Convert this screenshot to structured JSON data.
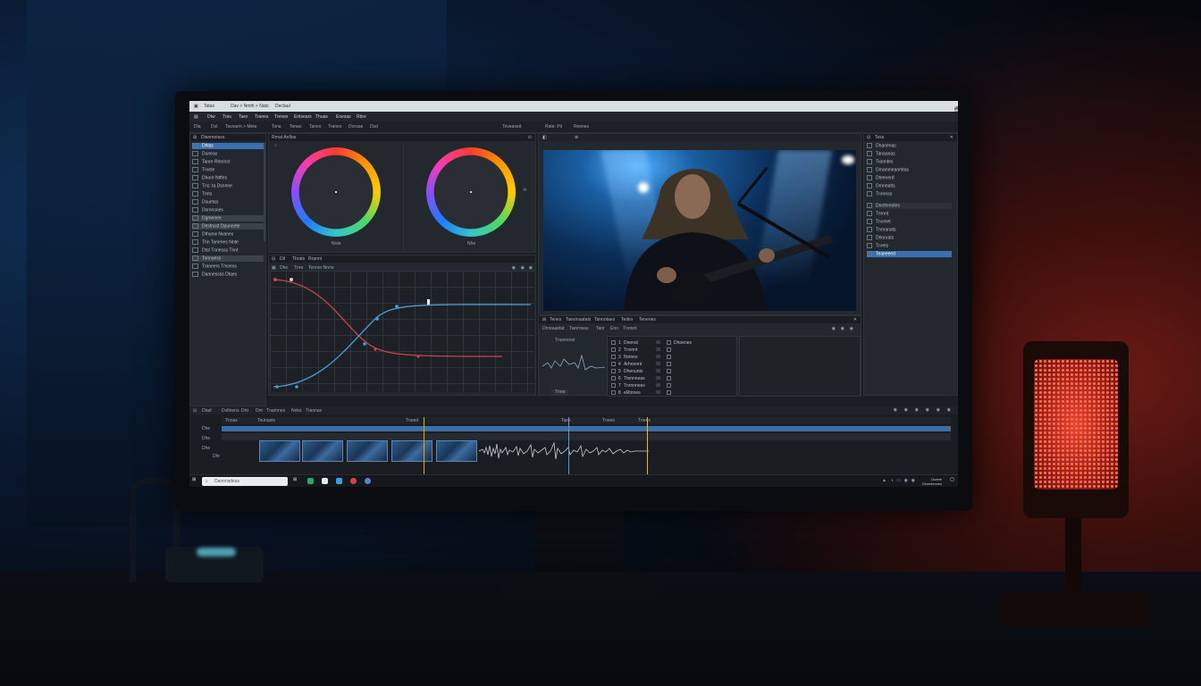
{
  "window": {
    "title_parts": [
      "Tatas",
      "Dav > Nmth > Nats",
      "Declaul"
    ],
    "controls": [
      "—",
      "▢",
      "✕"
    ]
  },
  "menu": [
    "Dtw",
    "Tras",
    "Taex",
    "Tranes",
    "Trenes",
    "Entsears",
    "Thuas",
    "Enesas",
    "Rbre"
  ],
  "toolbar": {
    "left": [
      "Dia",
      "Dxl",
      "Tavsaen > Mete",
      "Tsna",
      "Tenas",
      "Tanes",
      "Tranes",
      "Doraas",
      "Dsd"
    ],
    "viewer_tabs": [
      "Toveased",
      "Rate: Pil",
      "Resnes"
    ],
    "color_panel_title": "Rrnat Anlfas"
  },
  "left_panel": {
    "header": "Dianmetass",
    "items": [
      {
        "label": "Dhlas",
        "state": "selected"
      },
      {
        "label": "Duneas",
        "state": ""
      },
      {
        "label": "Tanre Rtennst",
        "state": ""
      },
      {
        "label": "Tnvtre",
        "state": ""
      },
      {
        "label": "Dhore Nttfes",
        "state": ""
      },
      {
        "label": "Tns: ta Dsnnne",
        "state": ""
      },
      {
        "label": "Trnts",
        "state": ""
      },
      {
        "label": "Dsuetas",
        "state": ""
      },
      {
        "label": "Dsrnnsnes",
        "state": ""
      },
      {
        "label": "Dgmenee",
        "state": "highlight"
      },
      {
        "label": "Destnsst Dpunnete",
        "state": "highlight"
      },
      {
        "label": "Dthunw Nvanes",
        "state": ""
      },
      {
        "label": "Thn Tanenes Nnte",
        "state": ""
      },
      {
        "label": "Dtst Tnnesss Tnnt",
        "state": ""
      },
      {
        "label": "Tonnaess",
        "state": "highlight"
      },
      {
        "label": "Traneers Tmoess",
        "state": ""
      },
      {
        "label": "Dannessss Dtaes",
        "state": ""
      }
    ]
  },
  "color_wheels": [
    {
      "label": "Nnte"
    },
    {
      "label": "Nhe"
    }
  ],
  "curves": {
    "tabs": [
      "Dtl",
      "Tbrats",
      "Rrannt"
    ],
    "subtabs": [
      "Dhe",
      "Tnre",
      "Tenner Nnne"
    ]
  },
  "viewer": {
    "tabs": [
      "Tenes",
      "Taesmaatats",
      "Tannotaes",
      "Tedes",
      "Tenenes"
    ],
    "row2": [
      "Dmnaaetat",
      "Twnrneas",
      "Tanr",
      "Enn",
      "Tnnnnt"
    ],
    "scope_label": "Tnanreest",
    "scope_footer": "Tnne"
  },
  "props": {
    "items": [
      {
        "num": "1",
        "label": "Dnenst"
      },
      {
        "num": "2",
        "label": "Tnvnnt"
      },
      {
        "num": "3",
        "label": "Nvtnes"
      },
      {
        "num": "4",
        "label": "Arhnnnnt"
      },
      {
        "num": "5",
        "label": "Dhenunts"
      },
      {
        "num": "6",
        "label": "Ttennneas"
      },
      {
        "num": "7",
        "label": "Tnrnnnees"
      },
      {
        "num": "8",
        "label": "eRtnnes"
      }
    ],
    "side": [
      "Dhoenes",
      "",
      "",
      "",
      "",
      "",
      "",
      ""
    ]
  },
  "right_panel": {
    "header": "Tess",
    "items": [
      {
        "label": "Dhanenas",
        "state": ""
      },
      {
        "label": "Tanaanas",
        "state": ""
      },
      {
        "label": "Tranntes",
        "state": ""
      },
      {
        "label": "Drnanmeanmtas",
        "state": ""
      },
      {
        "label": "Dteenerd",
        "state": ""
      },
      {
        "label": "Drnneatts",
        "state": ""
      },
      {
        "label": "Tnrneas",
        "state": ""
      },
      {
        "label": "Dnnttenotes",
        "state": "group"
      },
      {
        "label": "Tmnnt",
        "state": ""
      },
      {
        "label": "Tnvmet",
        "state": ""
      },
      {
        "label": "Tnrnanats",
        "state": ""
      },
      {
        "label": "Dhnnrats",
        "state": ""
      },
      {
        "label": "Tnrets",
        "state": ""
      },
      {
        "label": "Teaeeeed",
        "state": "selected"
      }
    ]
  },
  "timeline": {
    "header": [
      "Dtad",
      "Dvtlnens",
      "Drtr",
      "Dnt",
      "Tnarnnes",
      "Noks",
      "Trannas"
    ],
    "ruler": [
      "Tnnas",
      "Tounasts",
      "Tneed",
      "Tans",
      "Tnees",
      "Tnees"
    ],
    "tracks": [
      "Dhe",
      "Dhe",
      "Dhe",
      "Dhr"
    ]
  },
  "taskbar": {
    "search_placeholder": "Dannnsdeas",
    "clock": [
      "Dueee",
      "Dneeernnes"
    ]
  },
  "colors": {
    "accent": "#3a6fb0",
    "curve_blue": "#4a9ed8",
    "curve_red": "#c8464a"
  }
}
